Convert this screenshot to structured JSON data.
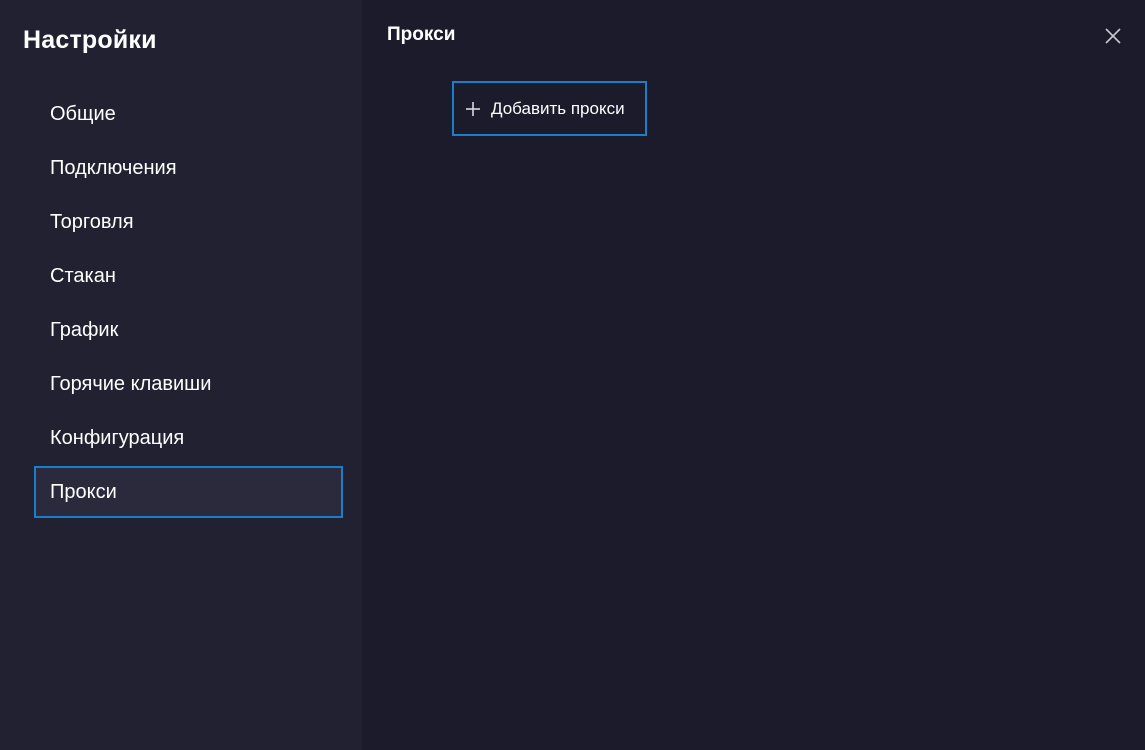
{
  "sidebar": {
    "title": "Настройки",
    "items": [
      {
        "label": "Общие"
      },
      {
        "label": "Подключения"
      },
      {
        "label": "Торговля"
      },
      {
        "label": "Стакан"
      },
      {
        "label": "График"
      },
      {
        "label": "Горячие клавиши"
      },
      {
        "label": "Конфигурация"
      },
      {
        "label": "Прокси"
      }
    ],
    "active_index": 7
  },
  "main": {
    "title": "Прокси",
    "add_button_label": "Добавить прокси",
    "add_icon": "plus-icon",
    "close_icon": "close-icon"
  },
  "colors": {
    "background": "#1c1b2b",
    "sidebar_background": "#222132",
    "active_item_background": "#2b2a3c",
    "accent_border": "#1a7fc8",
    "text": "#ffffff"
  }
}
